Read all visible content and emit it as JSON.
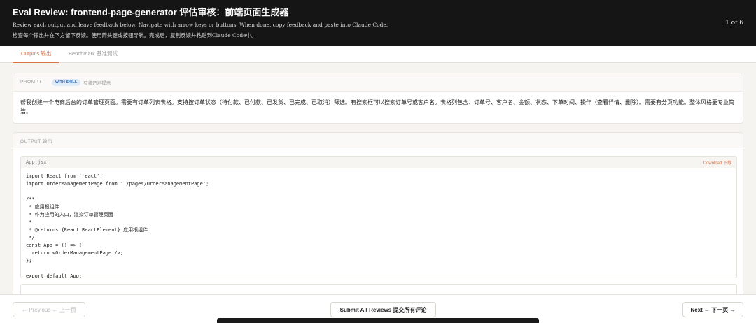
{
  "header": {
    "title": "Eval Review: frontend-page-generator 评估审核：前端页面生成器",
    "subtitle_en": "Review each output and leave feedback below. Navigate with arrow keys or buttons. When done, copy feedback and paste into Claude Code.",
    "subtitle_zh": "检查每个输出并在下方留下反馈。使用箭头键或按钮导航。完成后，复制反馈并粘贴到Claude Code中。",
    "counter": "1 of 6"
  },
  "tabs": [
    {
      "label": "Outputs 输出",
      "active": true
    },
    {
      "label": "Benchmark 基准测试",
      "active": false
    }
  ],
  "prompt": {
    "label": "PROMPT",
    "badge": "WITH SKILL",
    "badge_desc": "有技巧地提示",
    "text": "帮我创建一个电商后台的订单管理页面。需要有订单列表表格。支持按订单状态（待付款、已付款、已发货、已完成、已取消）筛选。有搜索框可以搜索订单号或客户名。表格列包含：订单号、客户名、金额、状态、下单时间、操作（查看详情、删除）。需要有分页功能。整体风格要专业简洁。"
  },
  "output": {
    "label": "OUTPUT 输出",
    "file_name": "App.jsx",
    "download_label": "Download 下载",
    "code": "import React from 'react';\nimport OrderManagementPage from './pages/OrderManagementPage';\n\n/**\n * 应用根组件\n * 作为应用的入口，渲染订单管理页面\n *\n * @returns {React.ReactElement} 应用根组件\n */\nconst App = () => {\n  return <OrderManagementPage />;\n};\n\nexport default App;"
  },
  "footer": {
    "prev_label": "← Previous ← 上一页",
    "submit_label": "Submit All Reviews 提交所有评论",
    "next_label": "Next → 下一页 →"
  },
  "colors": {
    "accent": "#d8734a",
    "header_bg": "#151515",
    "badge_bg": "#dfeaf7",
    "badge_text": "#3a72b5"
  }
}
